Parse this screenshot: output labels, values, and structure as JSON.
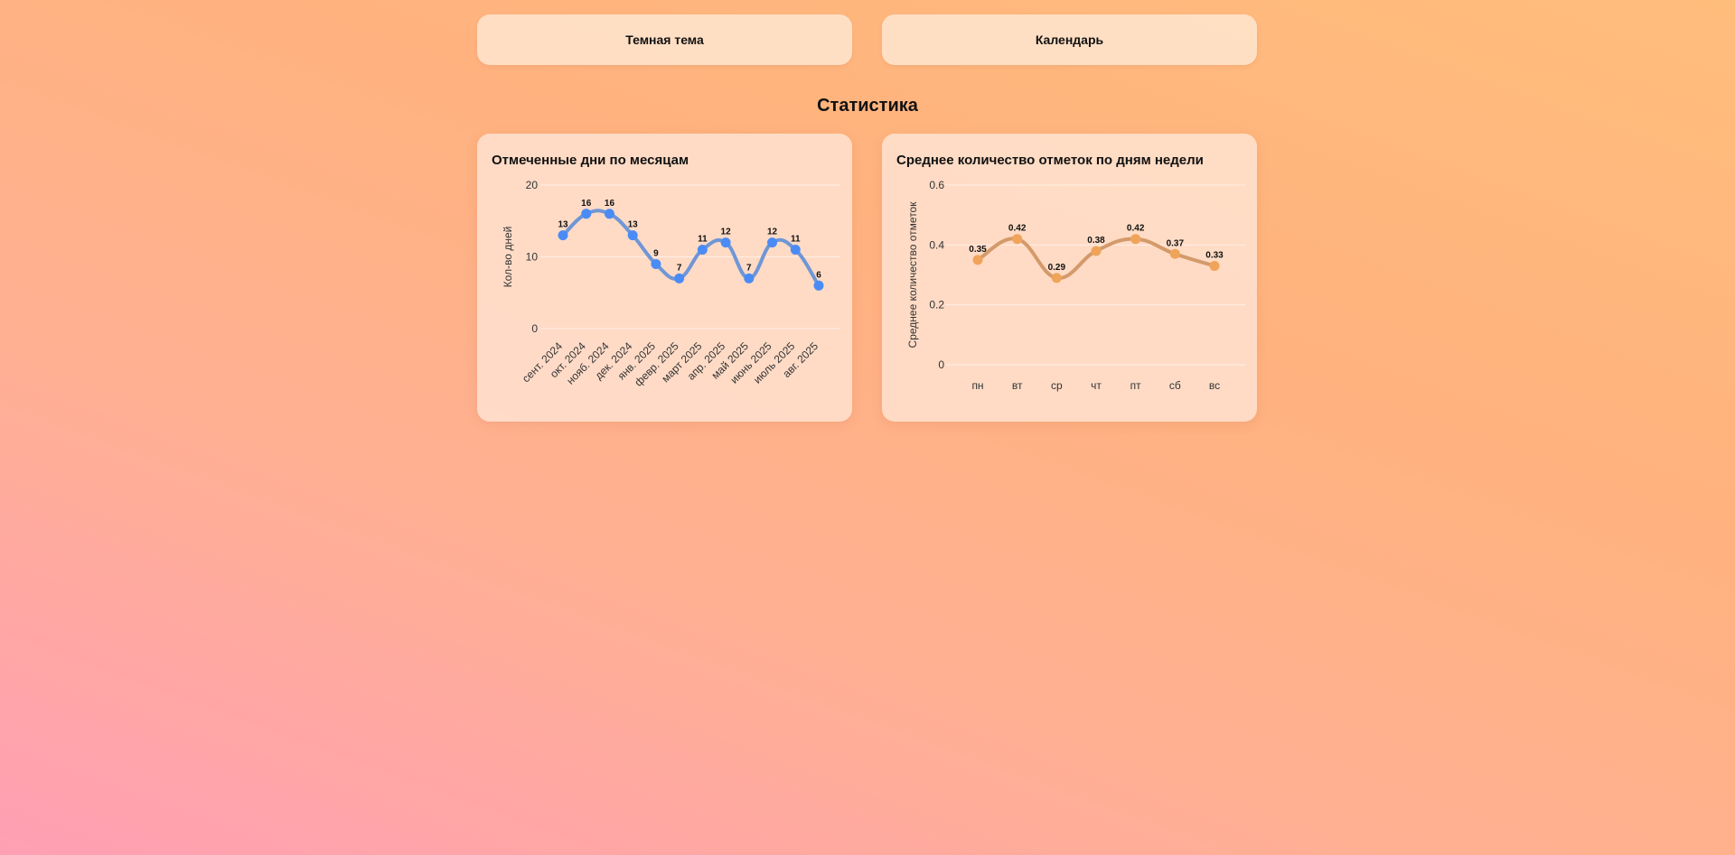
{
  "header": {
    "theme_button": "Темная тема",
    "calendar_button": "Календарь"
  },
  "section_title": "Статистика",
  "colors": {
    "line1": "#6f96d6",
    "point1": "#4b8bf5",
    "line2": "#d39a6a",
    "point2": "#f0a45a"
  },
  "chart_data": [
    {
      "type": "line",
      "title": "Отмеченные дни по месяцам",
      "ylabel": "Кол-во дней",
      "xlabel": "",
      "categories": [
        "сент. 2024",
        "окт. 2024",
        "нояб. 2024",
        "дек. 2024",
        "янв. 2025",
        "февр. 2025",
        "март 2025",
        "апр. 2025",
        "май 2025",
        "июнь 2025",
        "июль 2025",
        "авг. 2025"
      ],
      "values": [
        13,
        16,
        16,
        13,
        9,
        7,
        11,
        12,
        7,
        12,
        11,
        6
      ],
      "yticks": [
        "0",
        "10",
        "20"
      ],
      "ylim": [
        0,
        20
      ],
      "data_labels": true,
      "grid": true
    },
    {
      "type": "line",
      "title": "Среднее количество отметок по дням недели",
      "ylabel": "Среднее количество отметок",
      "xlabel": "",
      "categories": [
        "пн",
        "вт",
        "ср",
        "чт",
        "пт",
        "сб",
        "вс"
      ],
      "values": [
        0.35,
        0.42,
        0.29,
        0.38,
        0.42,
        0.37,
        0.33
      ],
      "yticks": [
        "0",
        "0.2",
        "0.4",
        "0.6"
      ],
      "ylim": [
        0,
        0.6
      ],
      "data_labels": true,
      "grid": true
    }
  ]
}
